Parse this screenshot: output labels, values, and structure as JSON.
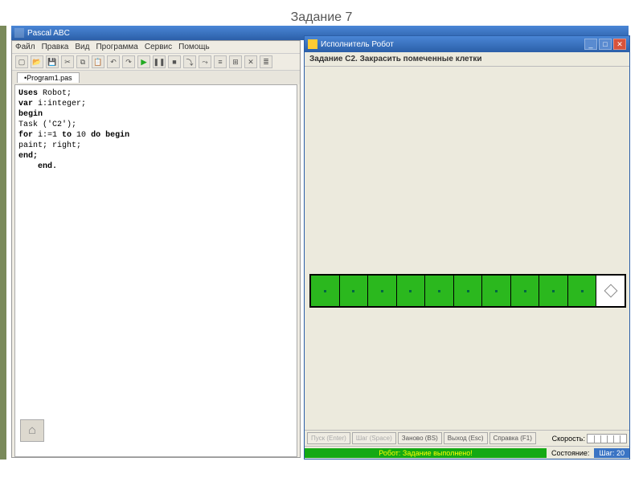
{
  "slide": {
    "title": "Задание 7"
  },
  "main": {
    "title": "Pascal ABC",
    "menu": [
      "Файл",
      "Правка",
      "Вид",
      "Программа",
      "Сервис",
      "Помощь"
    ],
    "tab": "Program1.pas",
    "code": {
      "l1a": "Uses",
      "l1b": " Robot;",
      "l2a": "var ",
      "l2b": "i:integer;",
      "l3": "begin",
      "l4": "Task ('C2');",
      "l5a": "for ",
      "l5b": "i:=1 ",
      "l5c": "to ",
      "l5d": "10 ",
      "l5e": "do begin",
      "l6": "paint; right;",
      "l7": "end;",
      "l8": "    end."
    }
  },
  "robot": {
    "title": "Исполнитель Робот",
    "task": "Задание C2. Закрасить помеченные клетки",
    "cells": [
      true,
      true,
      true,
      true,
      true,
      true,
      true,
      true,
      true,
      true,
      false
    ],
    "buttons": {
      "start": "Пуск (Enter)",
      "step": "Шаг (Space)",
      "reset": "Заново (BS)",
      "exit": "Выход (Esc)",
      "help": "Справка (F1)"
    },
    "speed_label": "Скорость:",
    "status_msg": "Робот: Задание выполнено!",
    "status_state": "Состояние:",
    "status_step": "Шаг: 20"
  }
}
